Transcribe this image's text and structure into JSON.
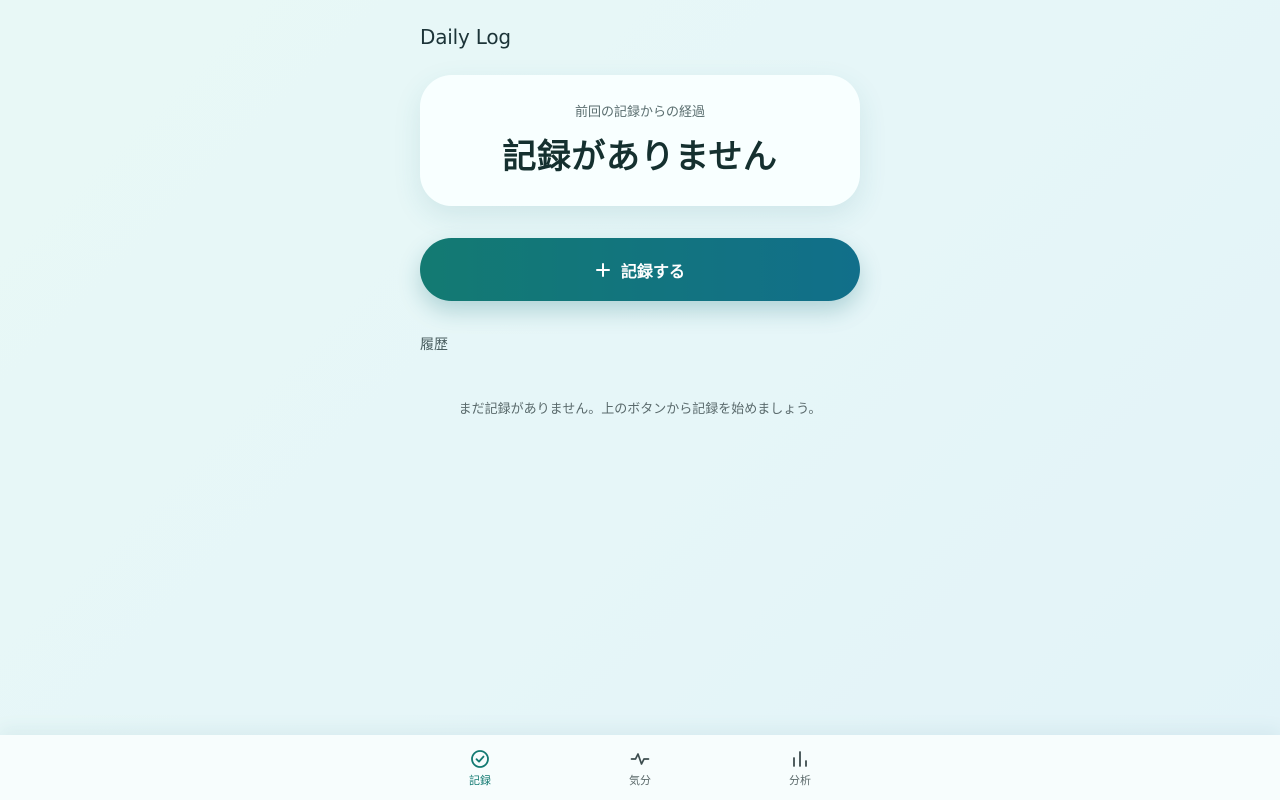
{
  "app": {
    "title": "Daily Log"
  },
  "status_card": {
    "label": "前回の記録からの経過",
    "value": "記録がありません"
  },
  "record_button": {
    "label": "記録する",
    "icon": "plus-icon"
  },
  "history": {
    "title": "履歴",
    "empty_message": "まだ記録がありません。上のボタンから記録を始めましょう。"
  },
  "nav": {
    "items": [
      {
        "label": "記録",
        "icon": "check-circle-icon",
        "active": true
      },
      {
        "label": "気分",
        "icon": "pulse-icon",
        "active": false
      },
      {
        "label": "分析",
        "icon": "bar-chart-icon",
        "active": false
      }
    ]
  },
  "colors": {
    "accent": "#137a72",
    "accent_end": "#116f8a",
    "text_dark": "#15302f",
    "text_muted": "#5a6e6f"
  }
}
